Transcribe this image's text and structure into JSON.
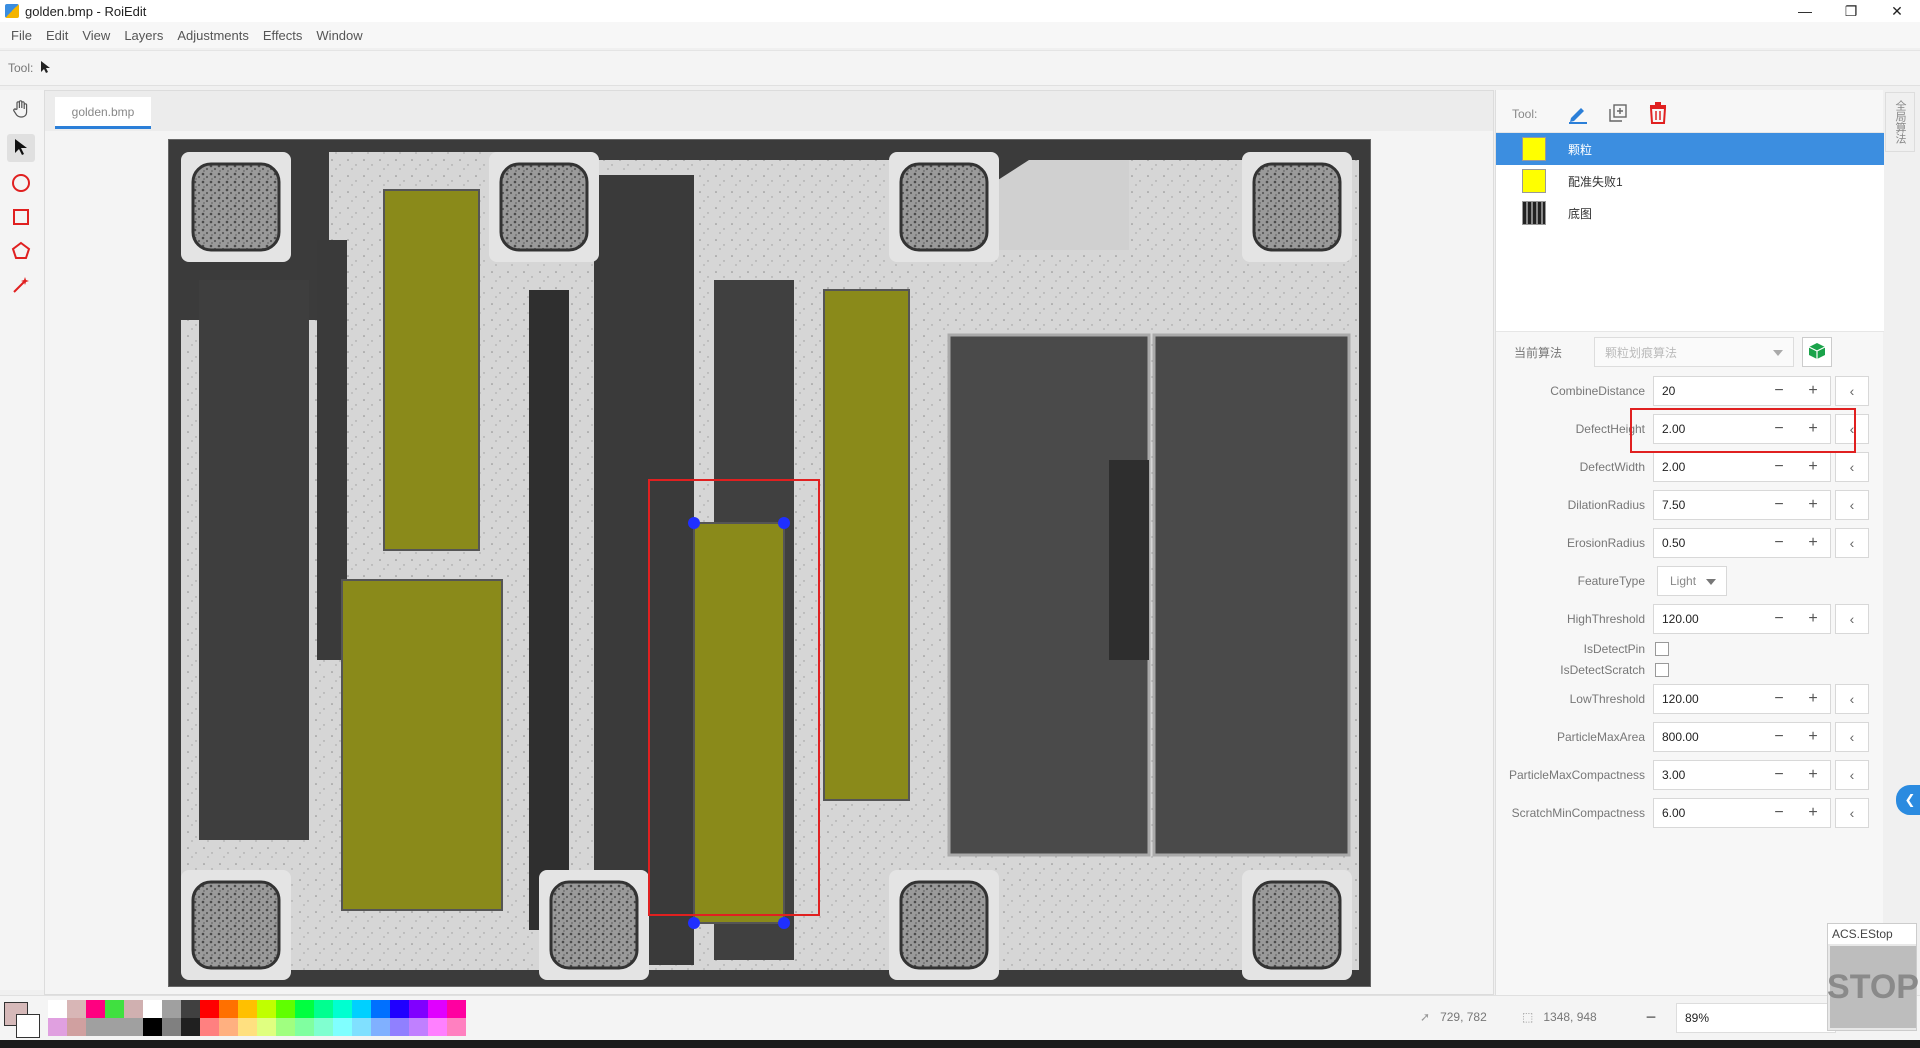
{
  "window": {
    "title": "golden.bmp - RoiEdit",
    "minimize": "—",
    "restore": "❐",
    "close": "✕"
  },
  "menu": [
    "File",
    "Edit",
    "View",
    "Layers",
    "Adjustments",
    "Effects",
    "Window"
  ],
  "toolbar": {
    "label": "Tool:"
  },
  "document": {
    "tab": "golden.bmp"
  },
  "right_panel": {
    "tool_label": "Tool:",
    "layers": [
      {
        "name": "颗粒",
        "swatch": "#ffff00",
        "selected": true
      },
      {
        "name": "配准失败1",
        "swatch": "#ffff00",
        "selected": false
      },
      {
        "name": "底图",
        "swatch": "#333333",
        "selected": false
      }
    ],
    "algo_label": "当前算法",
    "algo_value": "颗粒划痕算法",
    "side_tab": "全局算法",
    "params": [
      {
        "label": "CombineDistance",
        "value": "20",
        "kind": "number"
      },
      {
        "label": "DefectHeight",
        "value": "2.00",
        "kind": "number"
      },
      {
        "label": "DefectWidth",
        "value": "2.00",
        "kind": "number"
      },
      {
        "label": "DilationRadius",
        "value": "7.50",
        "kind": "number"
      },
      {
        "label": "ErosionRadius",
        "value": "0.50",
        "kind": "number"
      },
      {
        "label": "FeatureType",
        "value": "Light",
        "kind": "select"
      },
      {
        "label": "HighThreshold",
        "value": "120.00",
        "kind": "number"
      },
      {
        "label": "IsDetectPin",
        "value": "",
        "kind": "check"
      },
      {
        "label": "IsDetectScratch",
        "value": "",
        "kind": "check"
      },
      {
        "label": "LowThreshold",
        "value": "120.00",
        "kind": "number"
      },
      {
        "label": "ParticleMaxArea",
        "value": "800.00",
        "kind": "number"
      },
      {
        "label": "ParticleMaxCompactness",
        "value": "3.00",
        "kind": "number"
      },
      {
        "label": "ScratchMinCompactness",
        "value": "6.00",
        "kind": "number"
      }
    ],
    "minus": "−",
    "plus": "+",
    "back": "‹"
  },
  "status": {
    "cursor_pos": "729, 782",
    "selection_size": "1348, 948",
    "zoom_minus": "−",
    "zoom": "89%"
  },
  "estop": {
    "title": "ACS.EStop",
    "label": "STOP"
  },
  "colors": {
    "accent": "#2b7fd8",
    "selection": "#e02020",
    "overlay": "#8a8a1a",
    "handles": "#1f2fff"
  },
  "palette_top": [
    "#ffffff",
    "#d8b6b6",
    "#ff0080",
    "#40e040",
    "#d0b0b0",
    "#ffffff",
    "#a0a0a0",
    "#404040",
    "#ff0000",
    "#ff7000",
    "#ffc000",
    "#c0ff00",
    "#60ff00",
    "#00ff40",
    "#00ff90",
    "#00ffd0",
    "#00d0ff",
    "#0070ff",
    "#2000ff",
    "#8000ff",
    "#e000ff",
    "#ff00a0"
  ],
  "palette_bottom": [
    "#e0a0e0",
    "#d0a0a0",
    "#a0a0a0",
    "#a0a0a0",
    "#a0a0a0",
    "#000000",
    "#808080",
    "#202020",
    "#ff8080",
    "#ffb080",
    "#ffe080",
    "#e0ff80",
    "#a0ff80",
    "#80ffa0",
    "#80ffd0",
    "#80ffff",
    "#80e0ff",
    "#80b0ff",
    "#9080ff",
    "#c080ff",
    "#ff80ff",
    "#ff80c0"
  ]
}
